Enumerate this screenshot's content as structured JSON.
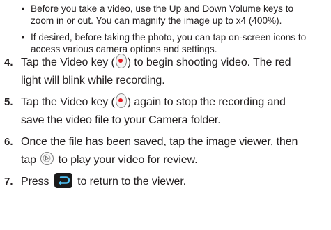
{
  "bullets": [
    {
      "lines": [
        "Before you take a video, use the Up and Down Volume keys to",
        "zoom in or out. You can magnify the image up to x4 (400%)."
      ]
    },
    {
      "lines": [
        "If desired, before taking the photo, you can tap on-screen icons to",
        "access various camera options and settings."
      ]
    }
  ],
  "steps": [
    {
      "number": "4.",
      "line1_before": "Tap the Video key (",
      "line1_after": ") to begin shooting video. The red",
      "line2": "light will blink while recording."
    },
    {
      "number": "5.",
      "line1_before": "Tap the Video key (",
      "line1_after": ") again to stop the recording and",
      "line2": "save the video file to your Camera folder."
    },
    {
      "number": "6.",
      "line1": "Once the file has been saved, tap the image viewer, then",
      "line2_before": "tap",
      "line2_after": "to play your video for review."
    },
    {
      "number": "7.",
      "line1_before": "Press",
      "line1_after": "to return to the viewer."
    }
  ],
  "icons": {
    "video_key": "video-key-icon",
    "play": "play-icon",
    "back": "back-icon"
  },
  "colors": {
    "text": "#231f20",
    "record_dot": "#e21b23"
  }
}
